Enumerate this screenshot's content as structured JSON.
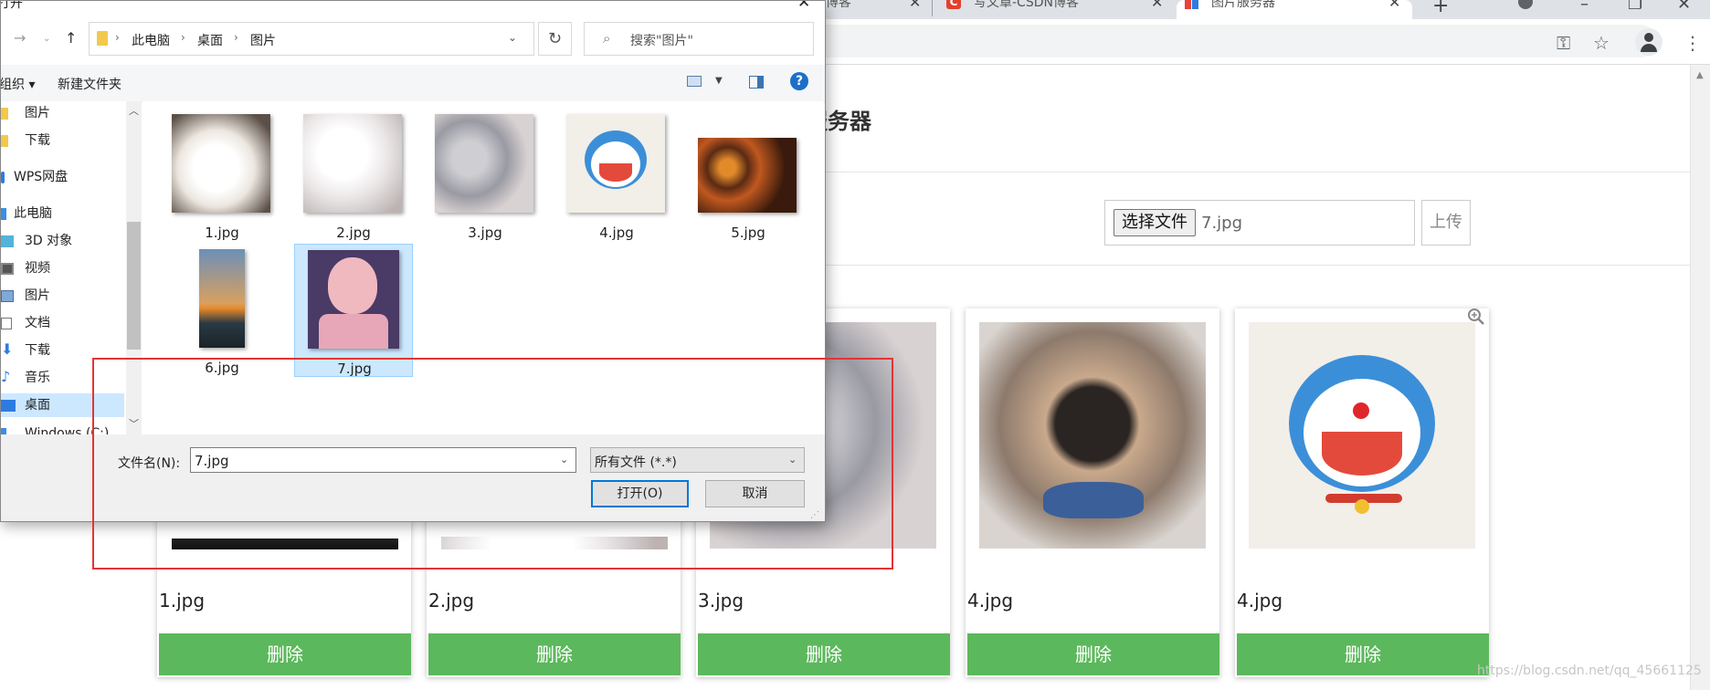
{
  "browser": {
    "tabs": [
      {
        "label": "l博客"
      },
      {
        "label": "写文章-CSDN博客"
      },
      {
        "label": "图片服务器"
      }
    ]
  },
  "page": {
    "title": "服务器",
    "choose_button": "选择文件",
    "selected_file": "7.jpg",
    "upload_button": "上传",
    "cards": [
      {
        "name": "1.jpg",
        "delete": "删除"
      },
      {
        "name": "2.jpg",
        "delete": "删除"
      },
      {
        "name": "3.jpg",
        "delete": "删除"
      },
      {
        "name": "4.jpg",
        "delete": "删除"
      },
      {
        "name": "4.jpg",
        "delete": "删除"
      }
    ],
    "watermark": "https://blog.csdn.net/qq_45661125"
  },
  "dialog": {
    "title": "打开",
    "breadcrumb": [
      "此电脑",
      "桌面",
      "图片"
    ],
    "search_placeholder": "搜索\"图片\"",
    "organize": "组织 ▾",
    "new_folder": "新建文件夹",
    "nav_items": [
      {
        "label": "图片",
        "icon": "folder-icon"
      },
      {
        "label": "下载",
        "icon": "folder-icon"
      },
      {
        "label": "WPS网盘",
        "icon": "cloud-icon"
      },
      {
        "label": "此电脑",
        "icon": "computer-icon"
      },
      {
        "label": "3D 对象",
        "icon": "cube-icon"
      },
      {
        "label": "视频",
        "icon": "video-icon"
      },
      {
        "label": "图片",
        "icon": "picture-icon"
      },
      {
        "label": "文档",
        "icon": "document-icon"
      },
      {
        "label": "下载",
        "icon": "download-icon"
      },
      {
        "label": "音乐",
        "icon": "music-icon"
      },
      {
        "label": "桌面",
        "icon": "desktop-icon"
      },
      {
        "label": "Windows (C:)",
        "icon": "drive-icon"
      }
    ],
    "files": [
      "1.jpg",
      "2.jpg",
      "3.jpg",
      "4.jpg",
      "5.jpg",
      "6.jpg",
      "7.jpg"
    ],
    "selected_file": "7.jpg",
    "filename_label": "文件名(N):",
    "filename_value": "7.jpg",
    "filetype": "所有文件 (*.*)",
    "open_button": "打开(O)",
    "cancel_button": "取消"
  },
  "colors": {
    "delete_green": "#5cb85c",
    "annotation_red": "#e53333",
    "selection_blue": "#cce8ff"
  }
}
